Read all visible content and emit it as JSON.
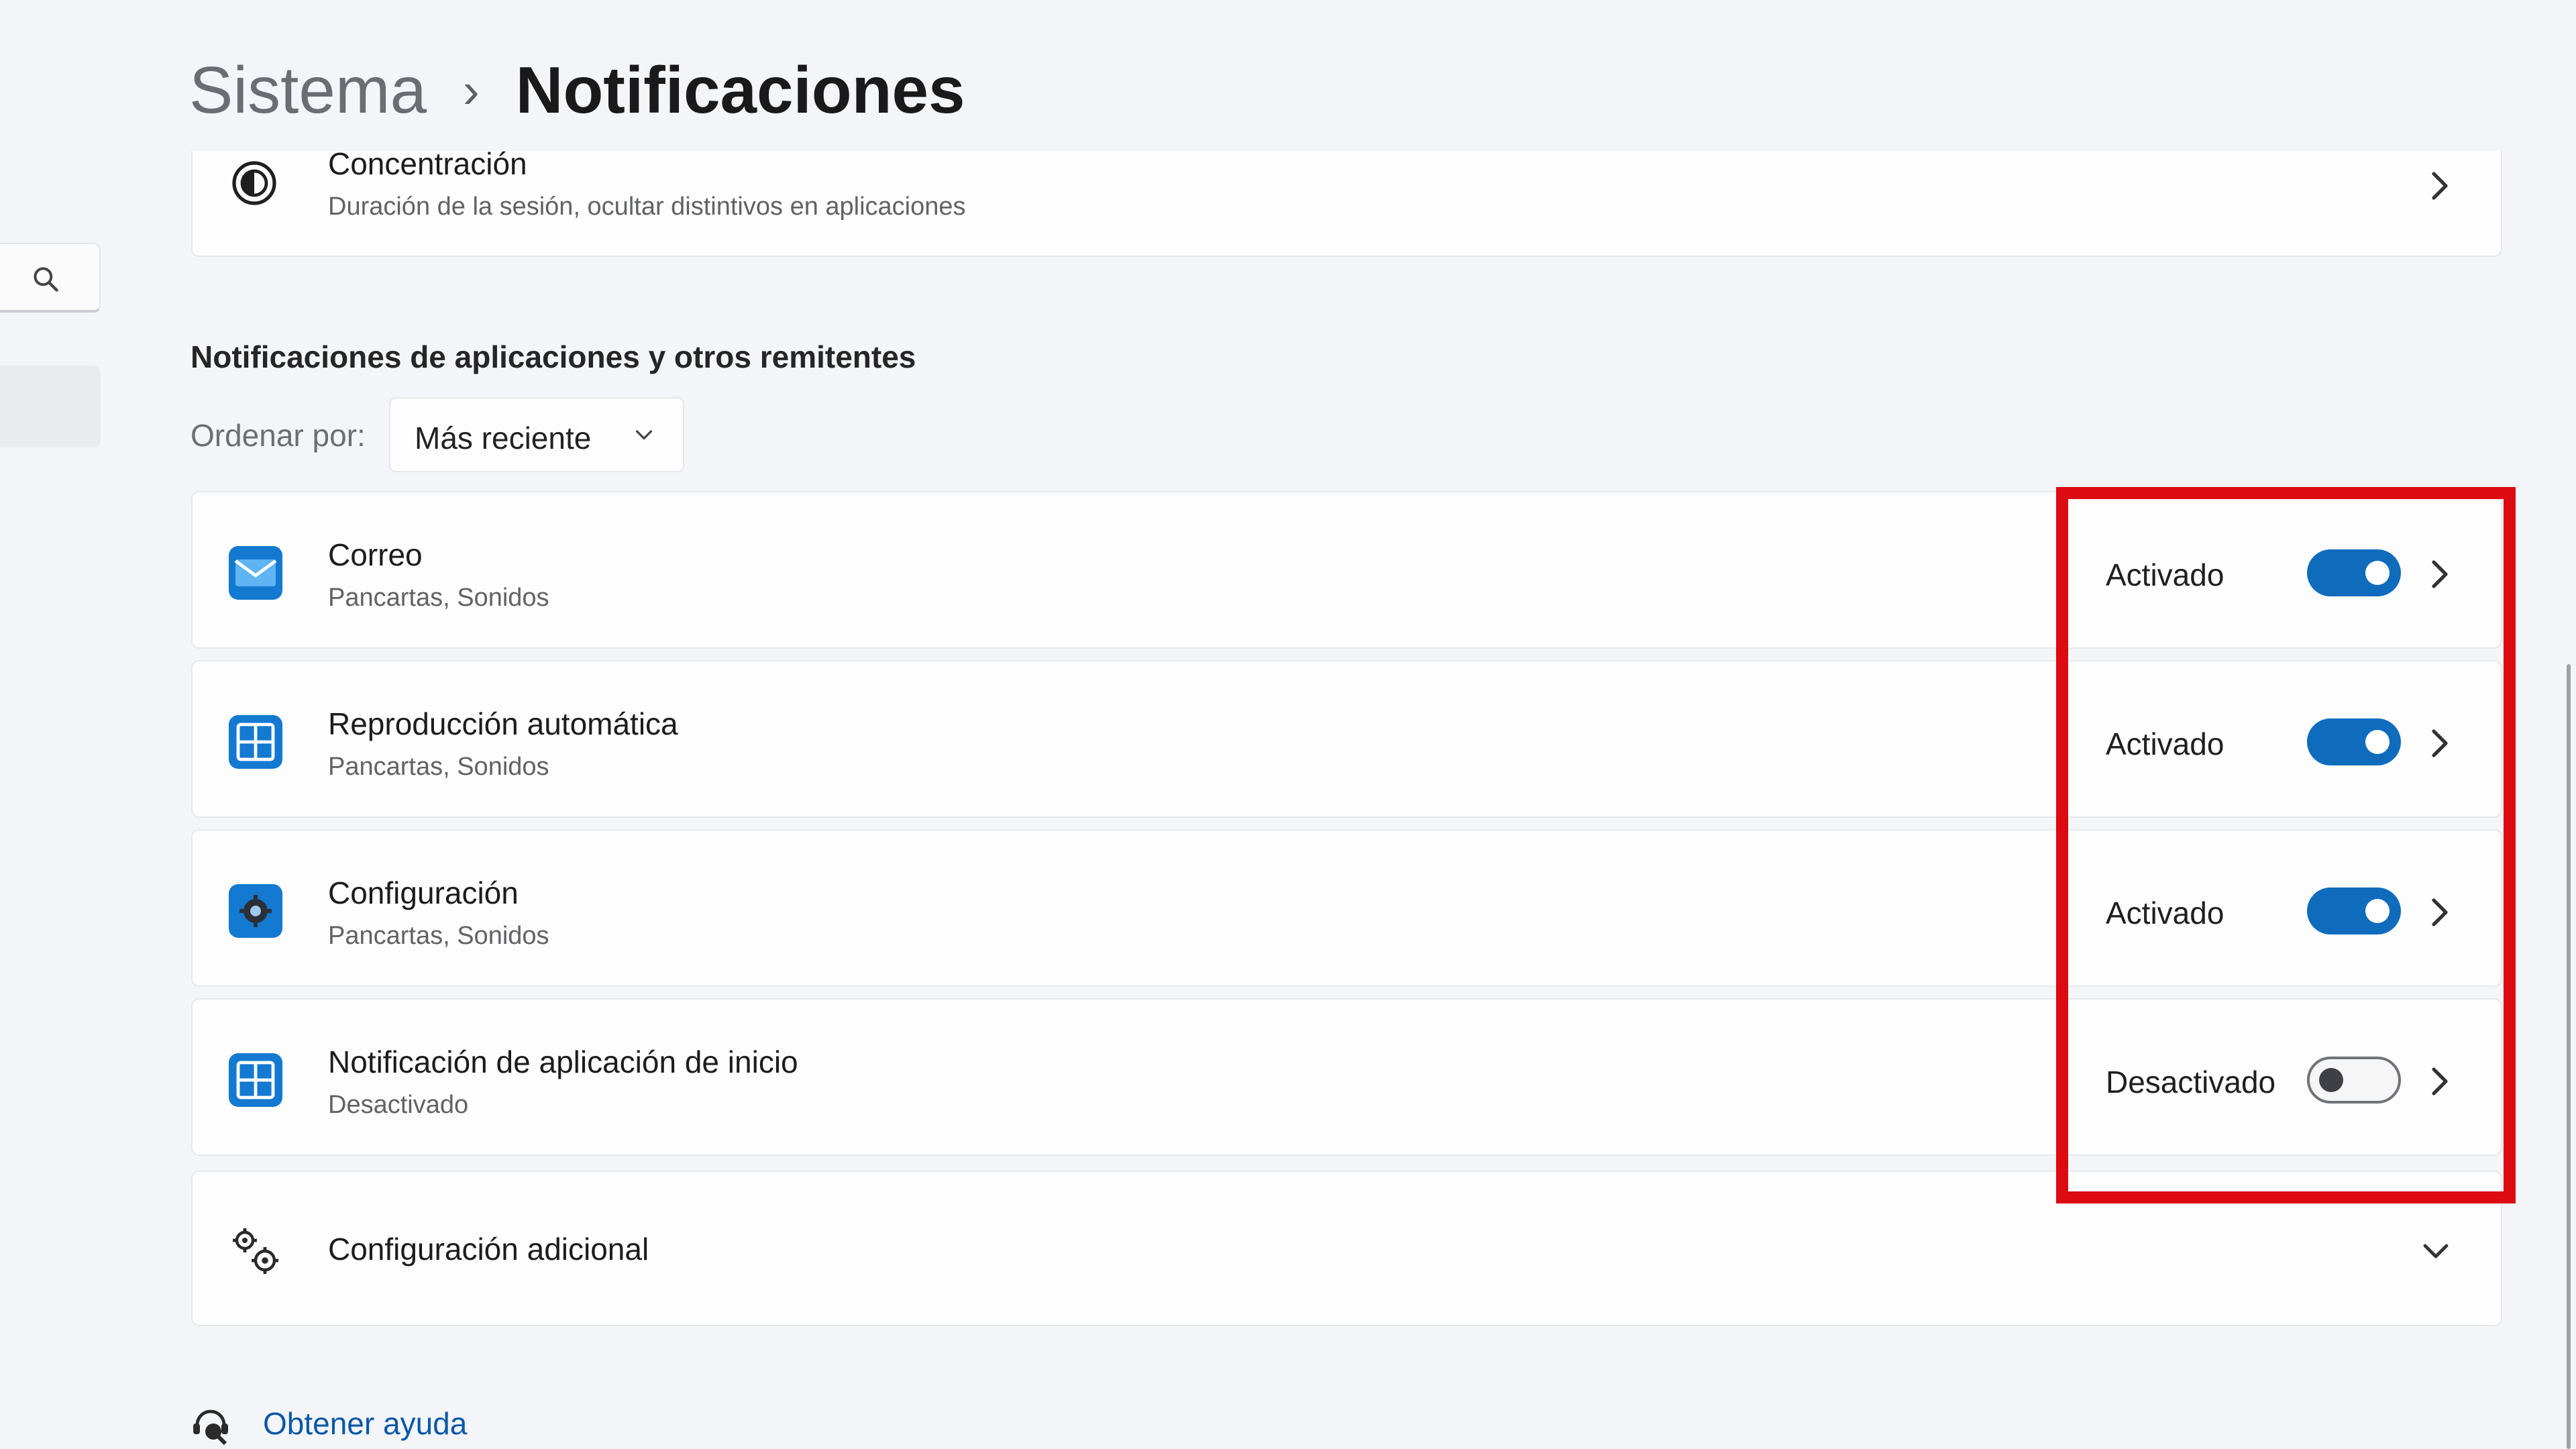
{
  "header": {
    "parent": "Sistema",
    "separator": "›",
    "current": "Notificaciones"
  },
  "focus": {
    "title": "Concentración",
    "subtitle": "Duración de la sesión, ocultar distintivos en aplicaciones",
    "icon": "focus-clock-icon"
  },
  "section": {
    "title": "Notificaciones de aplicaciones y otros remitentes",
    "sort_label": "Ordenar por:",
    "sort_value": "Más reciente"
  },
  "apps": [
    {
      "name": "Correo",
      "subtitle": "Pancartas, Sonidos",
      "status": "Activado",
      "enabled": true,
      "icon": "mail-icon"
    },
    {
      "name": "Reproducción automática",
      "subtitle": "Pancartas, Sonidos",
      "status": "Activado",
      "enabled": true,
      "icon": "autoplay-icon"
    },
    {
      "name": "Configuración",
      "subtitle": "Pancartas, Sonidos",
      "status": "Activado",
      "enabled": true,
      "icon": "settings-gear-icon"
    },
    {
      "name": "Notificación de aplicación de inicio",
      "subtitle": "Desactivado",
      "status": "Desactivado",
      "enabled": false,
      "icon": "startup-app-icon"
    }
  ],
  "extra": {
    "title": "Configuración adicional",
    "icon": "gears-icon"
  },
  "help": {
    "label": "Obtener ayuda",
    "icon": "help-agent-icon"
  },
  "colors": {
    "accent": "#0f6cbd",
    "highlight": "#dd0a12"
  }
}
